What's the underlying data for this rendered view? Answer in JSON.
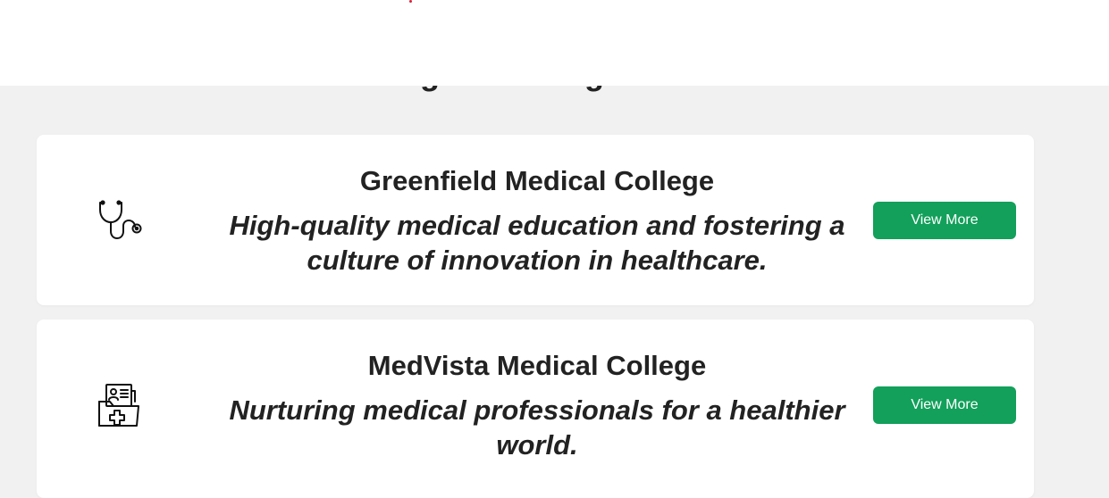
{
  "section": {
    "title": "Colleges offering Medical"
  },
  "colleges": [
    {
      "name": "Greenfield Medical College",
      "description": "High-quality medical education and fostering a culture of innovation in healthcare.",
      "icon": "stethoscope-icon",
      "button_label": "View More"
    },
    {
      "name": "MedVista Medical College",
      "description": "Nurturing medical professionals for a healthier world.",
      "icon": "medical-folder-icon",
      "button_label": "View More"
    }
  ],
  "colors": {
    "button": "#12a05a",
    "page_background": "#f1f1f1",
    "card_background": "#ffffff",
    "accent_dot": "#d6223b"
  }
}
